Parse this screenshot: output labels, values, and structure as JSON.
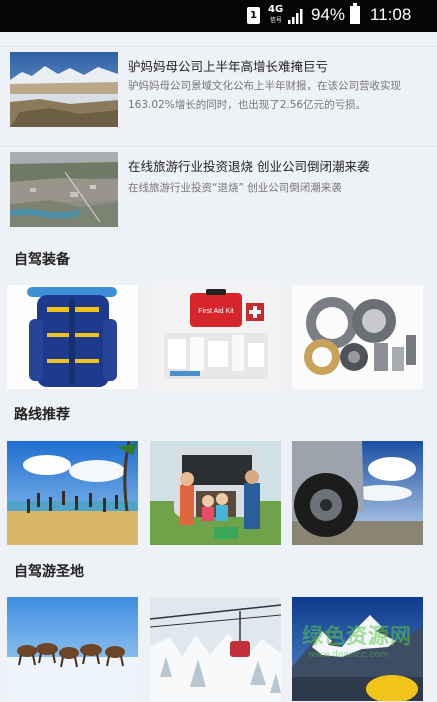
{
  "status_bar": {
    "sim_label": "1",
    "network": "4G",
    "network_sub": "信号",
    "battery_percent": "94%",
    "time": "11:08"
  },
  "news": [
    {
      "title": "驴妈妈母公司上半年高增长难掩巨亏",
      "desc": "驴妈妈母公司景域文化公布上半年财报，在该公司营收实现163.02%增长的同时，也出现了2.56亿元的亏损。",
      "thumb_icon": "mountain-lake-photo"
    },
    {
      "title": "在线旅游行业投资退烧 创业公司倒闭潮来袭",
      "desc": "在线旅游行业投资“退烧” 创业公司倒闭潮来袭",
      "thumb_icon": "city-aerial-photo"
    }
  ],
  "sections": [
    {
      "title": "自驾装备",
      "tiles": [
        "hiking-backpack-photo",
        "first-aid-kit-photo",
        "car-bearings-photo"
      ]
    },
    {
      "title": "路线推荐",
      "tiles": [
        "beach-jumping-group-photo",
        "family-car-trunk-photo",
        "offroad-tire-photo"
      ]
    },
    {
      "title": "自驾游圣地",
      "tiles": [
        "wild-horses-snow-photo",
        "snowy-cable-car-photo",
        "snow-mountain-photo"
      ]
    }
  ],
  "first_aid_label": "First Aid Kit",
  "watermark": {
    "text": "绿色资源网",
    "sub": "www.downcc.com"
  }
}
